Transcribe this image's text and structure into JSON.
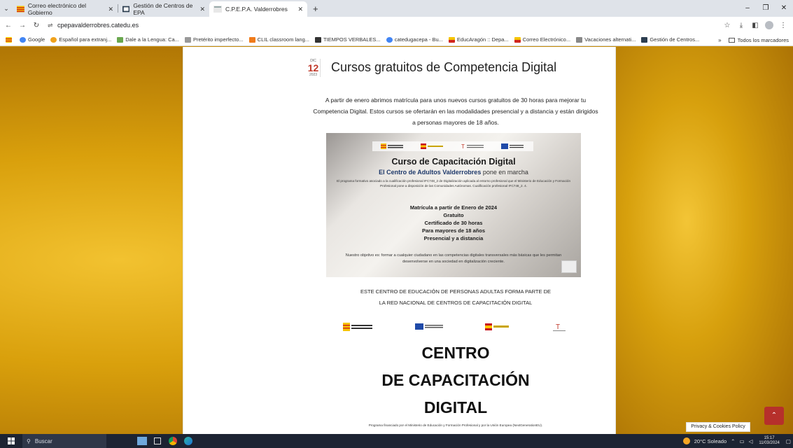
{
  "browser": {
    "tabs": [
      {
        "title": "Correo electrónico del Gobierno",
        "active": false
      },
      {
        "title": "Gestión de Centros de EPA",
        "active": false
      },
      {
        "title": "C.P.E.P.A. Valderrobres",
        "active": true
      }
    ],
    "url": "cpepavalderrobres.catedu.es",
    "bookmarks": [
      "Google",
      "Español para extranj...",
      "Dale a la Lengua: Ca...",
      "Pretérito imperfecto...",
      "CLIL classroom lang...",
      "TIEMPOS VERBALES...",
      "catedugacepa - Bu...",
      "EducAragón :: Depa...",
      "Correo Electrónico...",
      "Vacaciones alternati...",
      "Gestión de Centros..."
    ],
    "all_bookmarks": "Todos los marcadores"
  },
  "post": {
    "date": {
      "month": "DIC",
      "day": "12",
      "year": "2023"
    },
    "title": "Cursos gratuitos de Competencia Digital",
    "intro": "A partir de enero abrimos matrícula para unos nuevos cursos gratuitos de 30 horas para mejorar tu Competencia Digital. Estos cursos se ofertarán en las modalidades presencial y a distancia y están dirigidos a personas mayores de 18 años."
  },
  "flyer": {
    "logos": [
      "GOBIERNO DE ARAGON",
      "Gobierno de España",
      "TR",
      "Financiado por la Unión Europea"
    ],
    "title": "Curso de Capacitación Digital",
    "subtitle_bold": "El Centro de Adultos Valderrobres",
    "subtitle_rest": " pone en marcha",
    "description": "El programa formativo asociado a la cualificación profesional IFC748_2 de Digitalización aplicada al entorno profesional que el Ministerio de Educación y Formación Profesional pone a disposición de las Comunidades Autónomas. Cualificación profesional IFC748_2. 4.",
    "list": [
      "Matrícula a partir de Enero de 2024",
      "Gratuito",
      "Certificado de 30 horas",
      "Para  mayores de 18 años",
      "Presencial y a distancia"
    ],
    "footer": "Nuestro objetivo es: formar a cualquier ciudadano en las competencias digitales transversales más básicas que les permitan desenvolverse en una sociedad en digitalización creciente."
  },
  "network": {
    "line1": "ESTE CENTRO DE EDUCACIÓN DE PERSONAS ADULTAS FORMA PARTE DE",
    "line2": "LA RED NACIONAL DE CENTROS DE CAPACITACIÓN DIGITAL"
  },
  "big_title": [
    "CENTRO",
    "DE CAPACITACIÓN",
    "DIGITAL"
  ],
  "footnote": "Programa financiado por el Ministerio de Educación y Formación Profesional y por la Unión Europea (NextGenerationEU).",
  "privacy": "Privacy & Cookies Policy",
  "taskbar": {
    "search_placeholder": "Buscar",
    "weather": "20°C  Soleado",
    "time": "15:17",
    "date": "11/03/2024"
  },
  "colors": {
    "accent_red": "#c0392b",
    "scrolltop_bg": "#b6302b"
  }
}
